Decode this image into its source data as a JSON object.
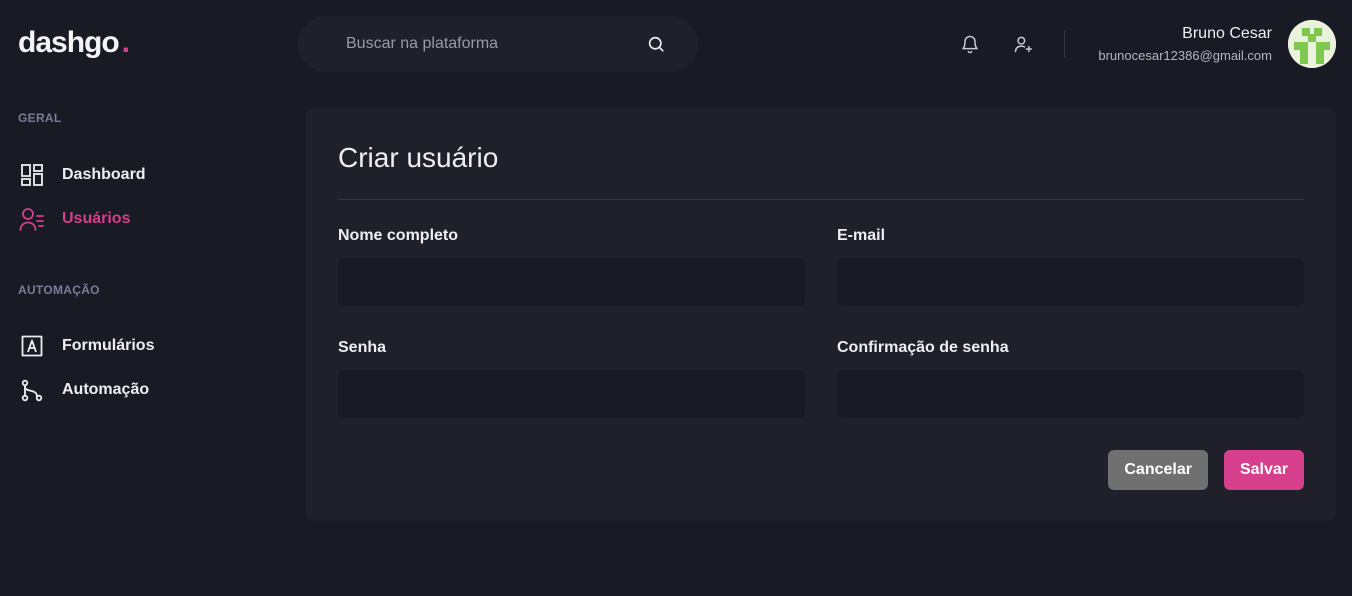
{
  "brand": {
    "name": "dashgo",
    "dot": ".",
    "accent": "#d53f8c"
  },
  "search": {
    "placeholder": "Buscar na plataforma",
    "icon": "search-icon"
  },
  "header": {
    "icons": [
      "bell-icon",
      "user-plus-icon"
    ],
    "user": {
      "name": "Bruno Cesar",
      "email": "brunocesar12386@gmail.com"
    }
  },
  "sidebar": {
    "sections": [
      {
        "title": "GERAL",
        "items": [
          {
            "label": "Dashboard",
            "icon": "dashboard-icon",
            "active": false
          },
          {
            "label": "Usuários",
            "icon": "users-icon",
            "active": true
          }
        ]
      },
      {
        "title": "AUTOMAÇÃO",
        "items": [
          {
            "label": "Formulários",
            "icon": "form-icon",
            "active": false
          },
          {
            "label": "Automação",
            "icon": "git-branch-icon",
            "active": false
          }
        ]
      }
    ]
  },
  "form": {
    "title": "Criar usuário",
    "fields": {
      "name": {
        "label": "Nome completo",
        "value": ""
      },
      "email": {
        "label": "E-mail",
        "value": ""
      },
      "password": {
        "label": "Senha",
        "value": ""
      },
      "password_confirmation": {
        "label": "Confirmação de senha",
        "value": ""
      }
    },
    "cancel_label": "Cancelar",
    "save_label": "Salvar"
  },
  "colors": {
    "background": "#181b23",
    "card": "#1f2029",
    "muted": "#797d9a",
    "cancel": "#707070"
  }
}
